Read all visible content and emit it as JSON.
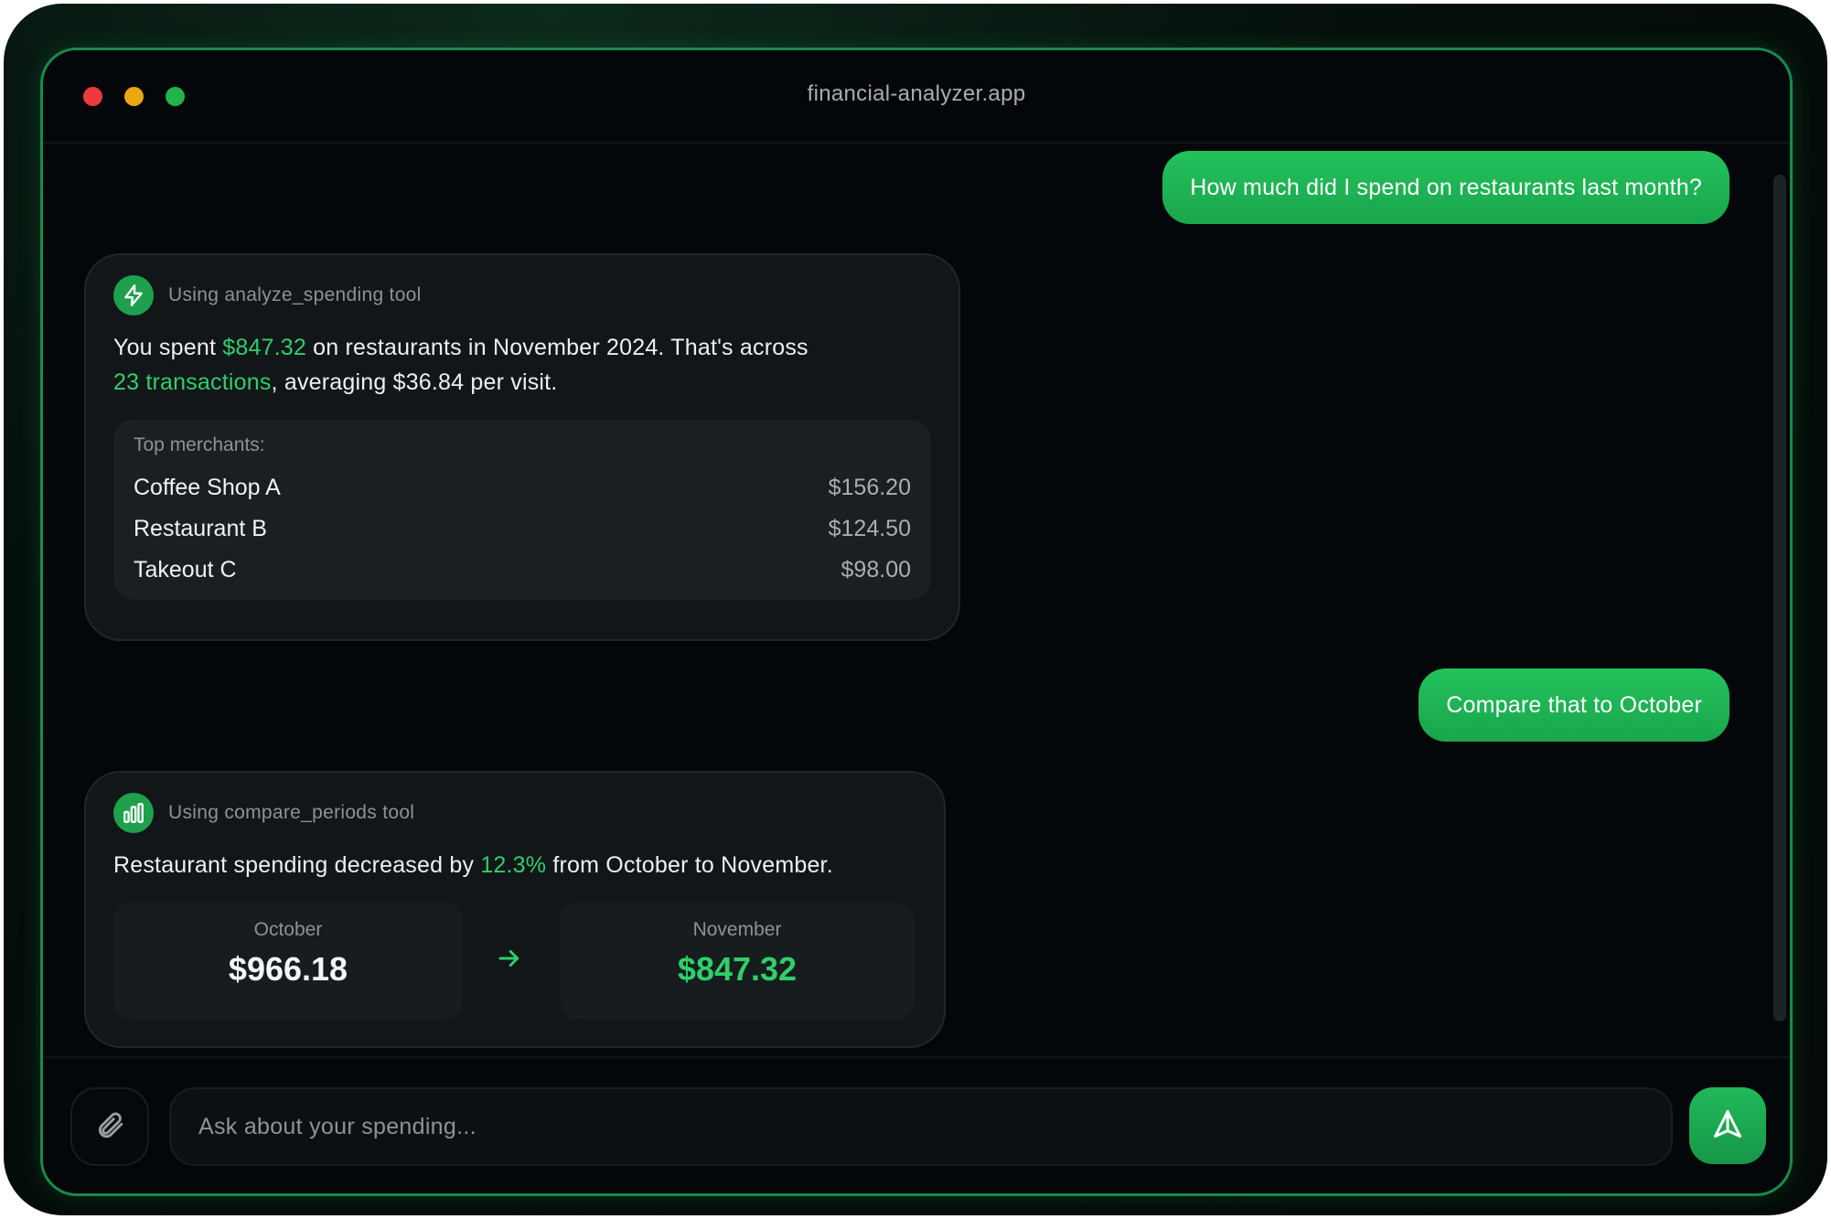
{
  "window": {
    "title": "financial-analyzer.app"
  },
  "colors": {
    "accent": "#22c55e",
    "background": "#03070a",
    "card": "#121619",
    "traffic_red": "#ed3b3b",
    "traffic_yellow": "#e9a913",
    "traffic_green": "#22b34a"
  },
  "messages": [
    {
      "role": "user",
      "text": "How much did I spend on restaurants last month?"
    },
    {
      "role": "assistant",
      "tool_icon": "lightning-icon",
      "tool_label": "Using analyze_spending tool",
      "text_parts": {
        "p1": "You spent ",
        "amount": "$847.32",
        "p2": " on restaurants in November 2024. That's across ",
        "transactions": "23 transactions",
        "p3": ", averaging $36.84 per visit."
      },
      "merchants_title": "Top merchants:",
      "merchants": [
        {
          "name": "Coffee Shop A",
          "amount": "$156.20"
        },
        {
          "name": "Restaurant B",
          "amount": "$124.50"
        },
        {
          "name": "Takeout C",
          "amount": "$98.00"
        }
      ]
    },
    {
      "role": "user",
      "text": "Compare that to October"
    },
    {
      "role": "assistant",
      "tool_icon": "bar-chart-icon",
      "tool_label": "Using compare_periods tool",
      "text_parts": {
        "p1": "Restaurant spending decreased by ",
        "percent": "12.3%",
        "p2": " from October to November."
      },
      "comparison": {
        "from": {
          "label": "October",
          "value": "$966.18"
        },
        "to": {
          "label": "November",
          "value": "$847.32"
        },
        "arrow_icon": "arrow-right-icon"
      }
    }
  ],
  "input": {
    "placeholder": "Ask about your spending...",
    "value": "",
    "attach_icon": "paperclip-icon",
    "send_icon": "send-icon"
  }
}
